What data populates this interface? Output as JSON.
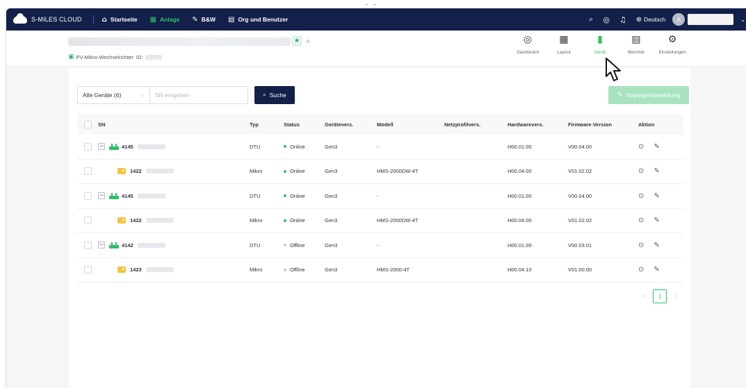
{
  "top_dots": "- -",
  "topbar": {
    "brand": "S-MILES CLOUD",
    "nav": [
      {
        "label": "Startseite",
        "icon": "home-icon",
        "glyph": "⌂",
        "active": false
      },
      {
        "label": "Anlage",
        "icon": "plant-icon",
        "glyph": "▦",
        "active": true
      },
      {
        "label": "B&W",
        "icon": "wrench-icon",
        "glyph": "✎",
        "active": false
      },
      {
        "label": "Org und Benutzer",
        "icon": "document-icon",
        "glyph": "▤",
        "active": false
      }
    ],
    "language": "Deutsch",
    "avatar_initial": "A"
  },
  "plant": {
    "subtitle": "PV-Mikro-Wechselrichter",
    "id_label": "ID:",
    "tabs": [
      {
        "label": "Dashboard",
        "icon": "dashboard-icon",
        "glyph": "◎",
        "active": false
      },
      {
        "label": "Layout",
        "icon": "layout-icon",
        "glyph": "▦",
        "active": false
      },
      {
        "label": "Gerät",
        "icon": "device-icon",
        "glyph": "▮",
        "active": true
      },
      {
        "label": "Berichte",
        "icon": "report-icon",
        "glyph": "▤",
        "active": false
      },
      {
        "label": "Einstellungen",
        "icon": "settings-icon",
        "glyph": "⚙",
        "active": false
      }
    ]
  },
  "filter": {
    "device_select": "Alle Geräte (6)",
    "sn_placeholder": "SN eingeben",
    "search_label": "Suche",
    "batch_label": "Stapelgerätewartung"
  },
  "table": {
    "headers": {
      "sn": "SN",
      "typ": "Typ",
      "status": "Status",
      "geraetevers": "Gerätevers.",
      "modell": "Modell",
      "netzprofil": "Netzprofilvers.",
      "hardware": "Hardwarevers.",
      "firmware": "Firmware-Version",
      "aktion": "Aktion"
    },
    "rows": [
      {
        "sn": "4145",
        "kind": "dtu",
        "typ": "DTU",
        "status": "Online",
        "ver": "Gen3",
        "modell": "-",
        "netz": "",
        "hw": "H00.01.00",
        "fw": "V00.04.00"
      },
      {
        "sn": "1422",
        "kind": "micro",
        "typ": "Mikro",
        "status": "Online",
        "ver": "Gen3",
        "modell": "HMS-2000DW-4T",
        "netz": "",
        "hw": "H00.04.00",
        "fw": "V01.02.02"
      },
      {
        "sn": "4145",
        "kind": "dtu",
        "typ": "DTU",
        "status": "Online",
        "ver": "Gen3",
        "modell": "-",
        "netz": "",
        "hw": "H00.01.00",
        "fw": "V00.04.00"
      },
      {
        "sn": "1422",
        "kind": "micro",
        "typ": "Mikro",
        "status": "Online",
        "ver": "Gen3",
        "modell": "HMS-2000DW-4T",
        "netz": "",
        "hw": "H00.04.00",
        "fw": "V01.02.02"
      },
      {
        "sn": "4142",
        "kind": "dtu",
        "typ": "DTU",
        "status": "Offline",
        "ver": "Gen3",
        "modell": "-",
        "netz": "",
        "hw": "H00.01.00",
        "fw": "V00.03.01"
      },
      {
        "sn": "1423",
        "kind": "micro",
        "typ": "Mikro",
        "status": "Offline",
        "ver": "Gen3",
        "modell": "HMS-2000-4T",
        "netz": "",
        "hw": "H00.04.10",
        "fw": "V01.00.00"
      }
    ]
  },
  "pagination": {
    "current": "1",
    "prev": "‹",
    "next": "›"
  },
  "colors": {
    "nav_bg": "#13204a",
    "accent_green": "#2fbf67",
    "batch_btn": "#a9e2bf",
    "micro_yellow": "#f6c33b"
  }
}
